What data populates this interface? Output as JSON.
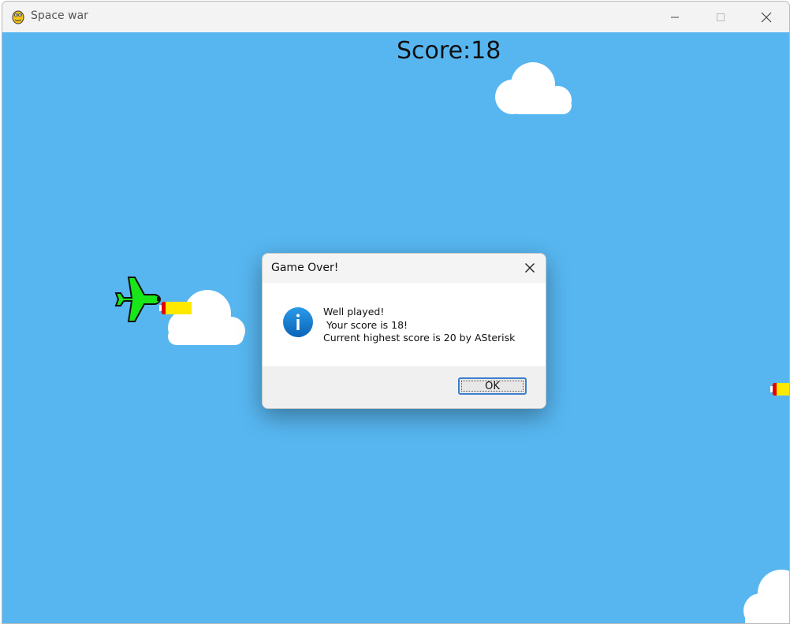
{
  "window": {
    "title": "Space war",
    "app_icon": "pygame-snake-icon",
    "controls": [
      "minimize-icon",
      "maximize-icon",
      "close-icon"
    ]
  },
  "game": {
    "score_text": "Score:18",
    "background_color": "#57b6f0",
    "player": "green-plane",
    "enemies": [
      "missile",
      "missile"
    ]
  },
  "dialog": {
    "title": "Game Over!",
    "icon": "info-icon",
    "line1": "Well played!",
    "line2": " Your score is 18!",
    "line3": "Current highest score is 20 by ASterisk",
    "ok_label": "OK"
  }
}
